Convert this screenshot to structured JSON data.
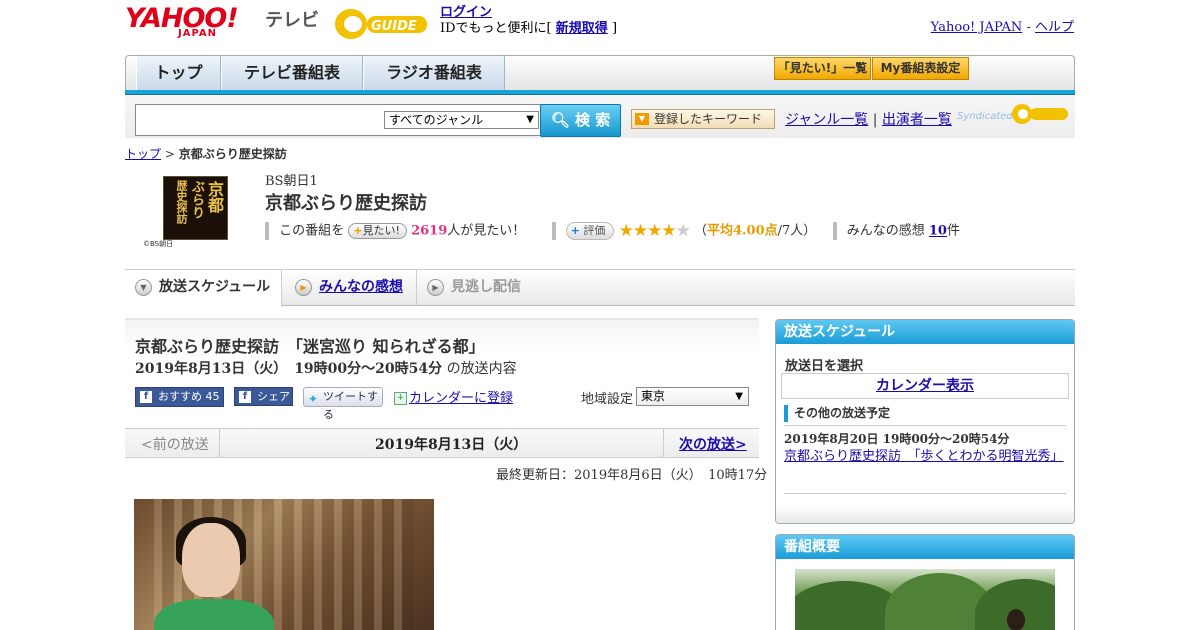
{
  "header": {
    "logo_yahoo": "YAHOO!",
    "logo_japan": "JAPAN",
    "logo_tv": "テレビ",
    "gguide": "GUIDE",
    "login": "ログイン",
    "login_sub_prefix": "IDでもっと便利に[",
    "register": "新規取得",
    "login_sub_suffix": "]",
    "yahoo_japan_link": "Yahoo! JAPAN",
    "dash": "-",
    "help_link": "ヘルプ"
  },
  "nav": {
    "tabs": [
      "トップ",
      "テレビ番組表",
      "ラジオ番組表"
    ],
    "mitai_list": "「見たい!」一覧",
    "my_schedule": "My番組表設定"
  },
  "search": {
    "genre": "すべてのジャンル",
    "button": "検 索",
    "keyword_button": "登録したキーワード",
    "genre_list": "ジャンル一覧",
    "divider": "|",
    "performer_list": "出演者一覧",
    "syndicated": "Syndicated"
  },
  "breadcrumb": {
    "top": "トップ",
    "sep": ">",
    "current": "京都ぶらり歴史探訪"
  },
  "program": {
    "image_text_1": "京都",
    "image_text_2": "ぶらり",
    "image_text_3": "歴史探訪",
    "copyright": "©BS朝日",
    "channel": "BS朝日1",
    "title": "京都ぶらり歴史探訪",
    "this_program": "この番組を",
    "mitai_btn": "見たい!",
    "mitai_count": "2619",
    "mitai_suffix": "人が見たい！",
    "rating_btn": "評価",
    "rating_stars": 4,
    "avg_open": "（",
    "avg_text": "平均4.00点",
    "avg_people": "/7人）",
    "review_label": "みんなの感想",
    "review_count": "10",
    "review_suffix": "件"
  },
  "subtabs": {
    "schedule": "放送スケジュール",
    "reviews": "みんなの感想",
    "catchup": "見逃し配信"
  },
  "episode": {
    "title": "京都ぶらり歴史探訪　「迷宮巡り 知られざる都」",
    "date": "2019年8月13日（火）　19時00分～20時54分",
    "date_suffix": "の放送内容",
    "fb_recommend": "おすすめ",
    "fb_count": "45",
    "fb_share": "シェア",
    "tweet": "ツイートする",
    "calendar": "カレンダーに登録",
    "region_label": "地域設定",
    "region": "東京",
    "prev": "<前の放送",
    "pager_date": "2019年8月13日（火）",
    "next": "次の放送>",
    "updated": "最終更新日：2019年8月6日（火）　10時17分"
  },
  "sidebar": {
    "schedule_header": "放送スケジュール",
    "select_label": "放送日を選択",
    "calendar_link": "カレンダー表示",
    "other_header": "その他の放送予定",
    "other_date": "2019年8月20日  19時00分～20時54分",
    "other_link": "京都ぶらり歴史探訪　「歩くとわかる明智光秀」",
    "overview_header": "番組概要"
  }
}
